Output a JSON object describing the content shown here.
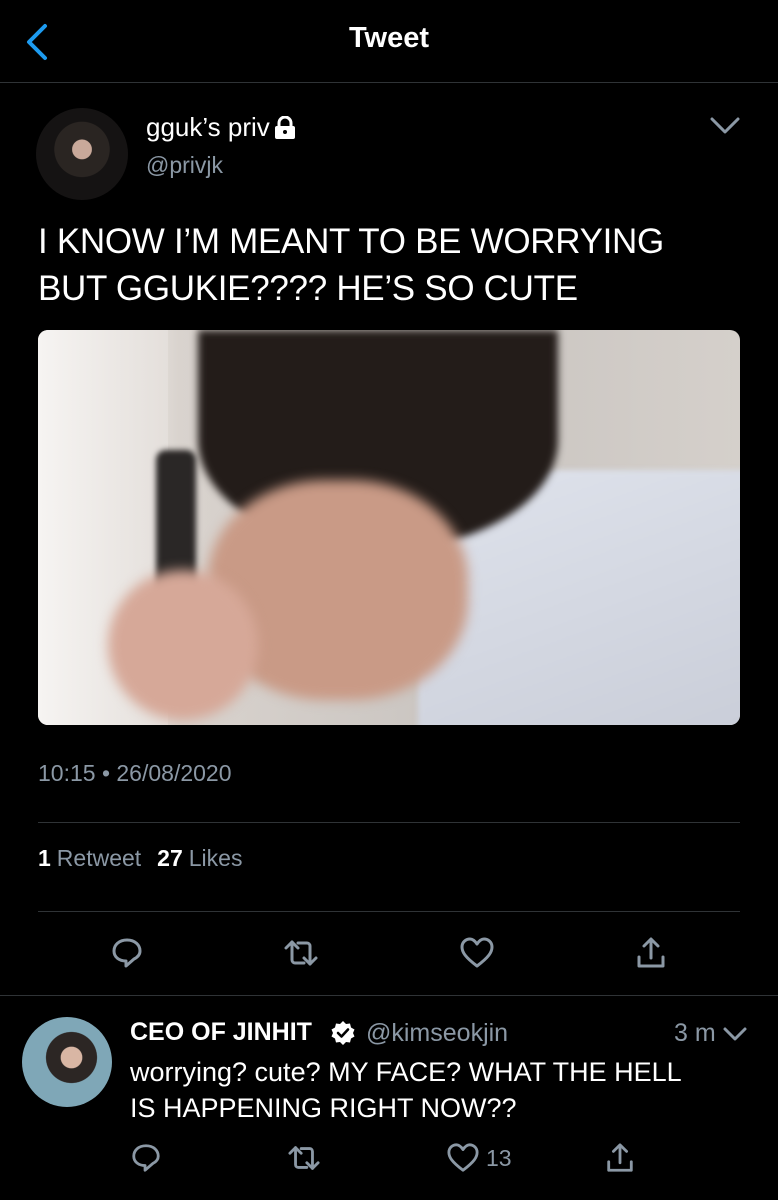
{
  "header": {
    "title": "Tweet",
    "accent_color": "#1d9bf0"
  },
  "tweet": {
    "display_name": "gguk’s priv",
    "handle": "@privjk",
    "protected_icon": "lock-icon",
    "text_line1": "I KNOW I’M MEANT TO BE WORRYING",
    "text_line2": "BUT GGUKIE???? HE’S SO CUTE",
    "timestamp": "10:15 • 26/08/2020",
    "retweet_count": "1",
    "retweet_label": "Retweet",
    "like_count": "27",
    "like_label": "Likes",
    "actions": [
      "reply-icon",
      "retweet-icon",
      "like-icon",
      "share-icon"
    ]
  },
  "reply": {
    "display_name": "CEO OF JINHIT",
    "verified_icon": "verified-icon",
    "handle": "@kimseokjin",
    "time": "3 m",
    "text_line1": "worrying? cute? MY FACE? WHAT THE HELL",
    "text_line2": "IS HAPPENING RIGHT NOW??",
    "like_count": "13",
    "actions": [
      "reply-icon",
      "retweet-icon",
      "like-icon",
      "share-icon"
    ]
  },
  "colors": {
    "background": "#000000",
    "text": "#ffffff",
    "secondary_text": "#8b98a5",
    "divider": "#2f3336",
    "icon": "#8b98a5"
  }
}
